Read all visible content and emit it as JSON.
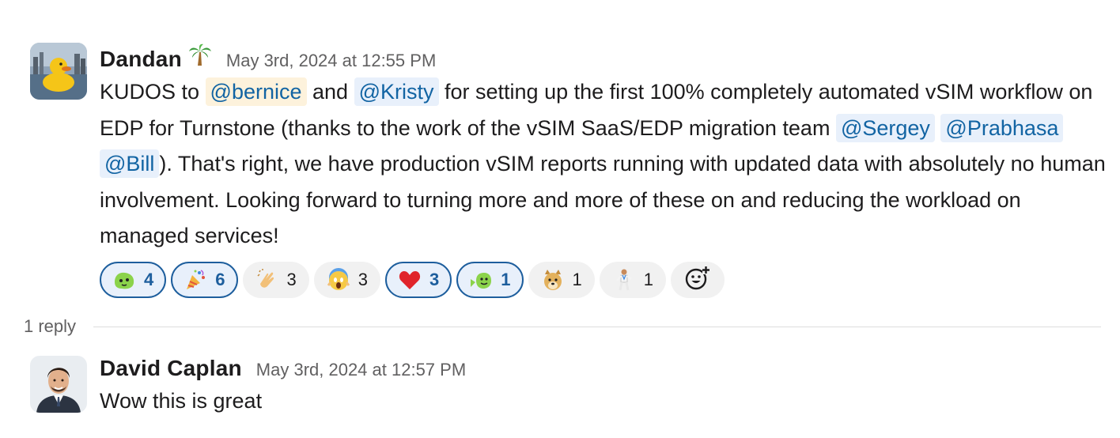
{
  "thread": {
    "message": {
      "author": "Dandan",
      "author_emoji": "palm-tree-icon",
      "timestamp": "May 3rd, 2024 at 12:55 PM",
      "text": {
        "t1": "KUDOS to ",
        "m1": "@bernice",
        "t2": " and ",
        "m2": "@Kristy",
        "t3": " for setting up the first 100% completely automated vSIM workflow on EDP for Turnstone (thanks to the work of the vSIM SaaS/EDP migration team ",
        "m3": "@Sergey",
        "m4": "@Prabhasa",
        "m5": "@Bill",
        "t4": "). That's right, we have production vSIM reports running with updated data with absolutely no human involvement. Looking forward to turning more and more of these on and reducing the workload on managed services!"
      },
      "reactions": [
        {
          "icon": "party-blob-icon",
          "count": "4",
          "active": true
        },
        {
          "icon": "party-popper-icon",
          "count": "6",
          "active": true
        },
        {
          "icon": "clapping-hands-icon",
          "count": "3",
          "active": false
        },
        {
          "icon": "screaming-face-icon",
          "count": "3",
          "active": false
        },
        {
          "icon": "red-heart-icon",
          "count": "3",
          "active": true
        },
        {
          "icon": "blob-wave-icon",
          "count": "1",
          "active": true
        },
        {
          "icon": "doge-icon",
          "count": "1",
          "active": false
        },
        {
          "icon": "person-dancing-icon",
          "count": "1",
          "active": false
        }
      ],
      "add_reaction_icon": "add-reaction-icon"
    },
    "reply_count": "1 reply",
    "reply": {
      "author": "David Caplan",
      "timestamp": "May 3rd, 2024 at 12:57 PM",
      "text": "Wow this is great"
    }
  },
  "colors": {
    "mention_bg": "#e8f0fb",
    "mention_self_bg": "#fdf2dc",
    "mention_fg": "#1264a3",
    "active_reaction_border": "#1d5e9d",
    "timestamp": "#616061"
  }
}
